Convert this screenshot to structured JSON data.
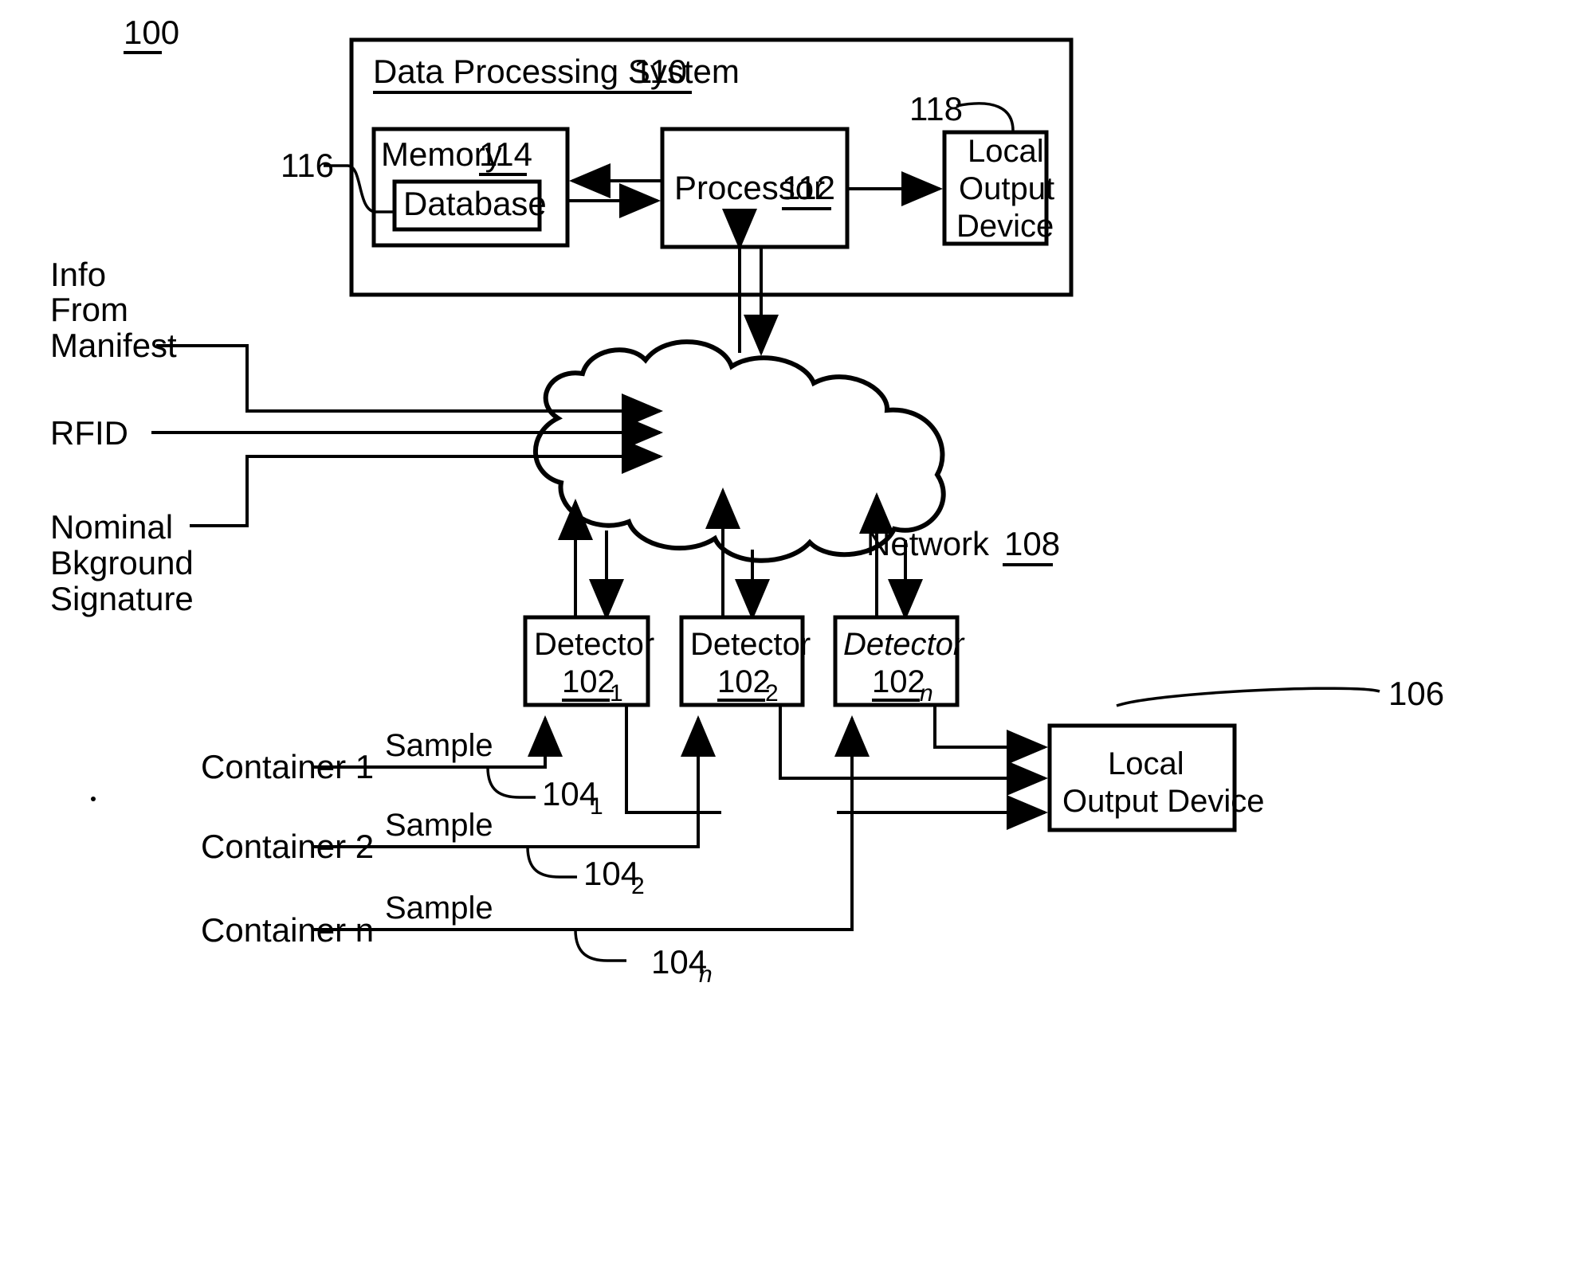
{
  "figure": {
    "number": "100"
  },
  "system_box": {
    "title": "Data Processing System",
    "ref": "110",
    "memory": {
      "title": "Memory",
      "ref": "114",
      "database_label": "Database",
      "database_ref": "116"
    },
    "processor": {
      "title": "Processor",
      "ref": "112"
    },
    "local_output": {
      "line1": "Local",
      "line2": "Output",
      "line3": "Device",
      "ref": "118"
    }
  },
  "inputs": [
    {
      "name": "info-from-manifest",
      "lines": [
        "Info",
        "From",
        "Manifest"
      ]
    },
    {
      "name": "rfid",
      "lines": [
        "RFID"
      ]
    },
    {
      "name": "nominal-bkground-signature",
      "lines": [
        "Nominal",
        "Bkground",
        "Signature"
      ]
    }
  ],
  "network": {
    "label": "Network",
    "ref": "108"
  },
  "detectors": [
    {
      "label": "Detector",
      "ref": "102",
      "sub": "1",
      "italic": false
    },
    {
      "label": "Detector",
      "ref": "102",
      "sub": "2",
      "italic": false
    },
    {
      "label": "Detector",
      "ref": "102",
      "sub": "n",
      "italic": true
    }
  ],
  "containers": [
    {
      "label": "Container 1",
      "sample_label": "Sample",
      "ref": "104",
      "sub": "1"
    },
    {
      "label": "Container 2",
      "sample_label": "Sample",
      "ref": "104",
      "sub": "2"
    },
    {
      "label": "Container n",
      "sample_label": "Sample",
      "ref": "104",
      "sub": "n"
    }
  ],
  "bottom_output": {
    "line1": "Local",
    "line2": "Output Device",
    "ref": "106"
  },
  "colors": {
    "ink": "#000000",
    "paper": "#ffffff"
  }
}
